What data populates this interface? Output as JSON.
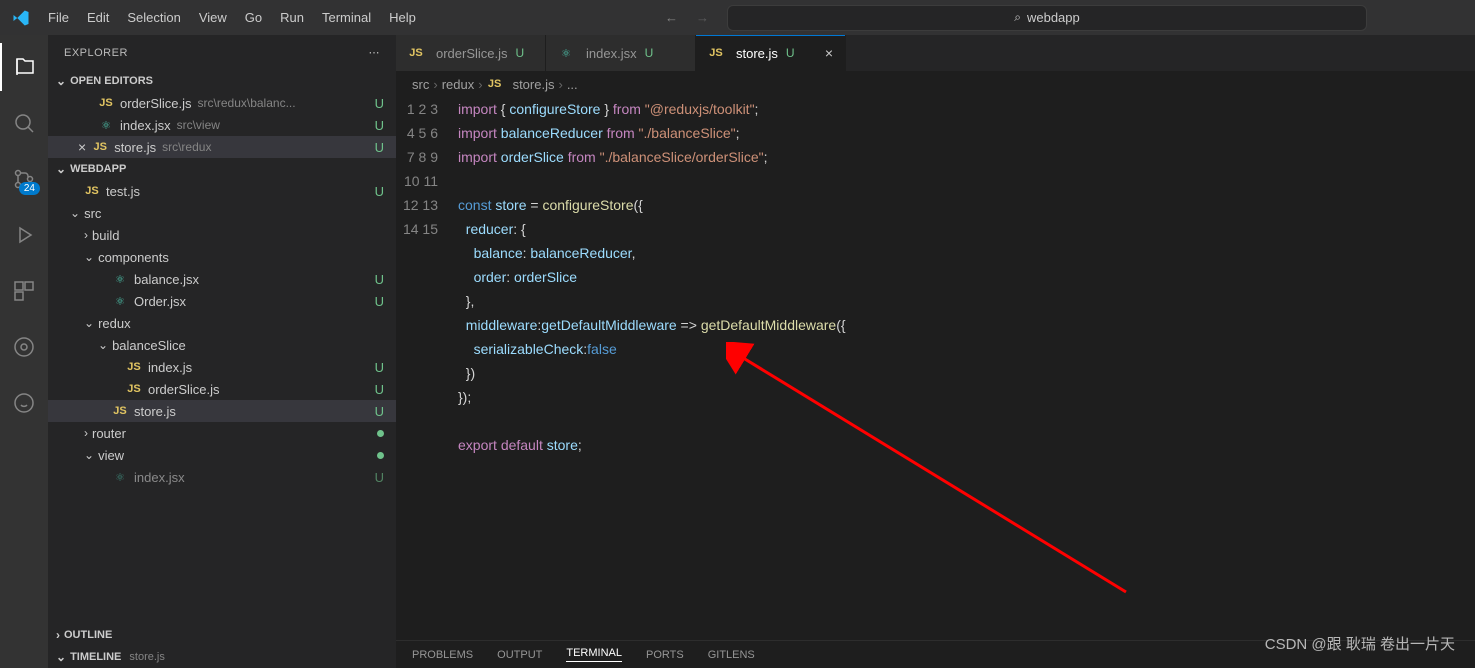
{
  "menu": [
    "File",
    "Edit",
    "Selection",
    "View",
    "Go",
    "Run",
    "Terminal",
    "Help"
  ],
  "search": {
    "placeholder": "webdapp"
  },
  "activity": {
    "badge": "24"
  },
  "sidebar": {
    "title": "EXPLORER",
    "openEditors": {
      "label": "OPEN EDITORS",
      "items": [
        {
          "icon": "JS",
          "name": "orderSlice.js",
          "path": "src\\redux\\balanc...",
          "status": "U"
        },
        {
          "icon": "⚛",
          "name": "index.jsx",
          "path": "src\\view",
          "status": "U"
        },
        {
          "icon": "JS",
          "name": "store.js",
          "path": "src\\redux",
          "status": "U",
          "active": true
        }
      ]
    },
    "project": {
      "label": "WEBDAPP",
      "tree": [
        {
          "indent": 1,
          "icon": "JS",
          "name": "test.js",
          "status": "U"
        },
        {
          "indent": 1,
          "chev": "down",
          "name": "src"
        },
        {
          "indent": 2,
          "chev": "right",
          "name": "build"
        },
        {
          "indent": 2,
          "chev": "down",
          "name": "components"
        },
        {
          "indent": 3,
          "icon": "⚛",
          "name": "balance.jsx",
          "status": "U"
        },
        {
          "indent": 3,
          "icon": "⚛",
          "name": "Order.jsx",
          "status": "U"
        },
        {
          "indent": 2,
          "chev": "down",
          "name": "redux"
        },
        {
          "indent": 3,
          "chev": "down",
          "name": "balanceSlice"
        },
        {
          "indent": 4,
          "icon": "JS",
          "name": "index.js",
          "status": "U"
        },
        {
          "indent": 4,
          "icon": "JS",
          "name": "orderSlice.js",
          "status": "U"
        },
        {
          "indent": 3,
          "icon": "JS",
          "name": "store.js",
          "status": "U",
          "selected": true
        },
        {
          "indent": 2,
          "chev": "right",
          "name": "router",
          "dot": true
        },
        {
          "indent": 2,
          "chev": "down",
          "name": "view",
          "dot": true
        },
        {
          "indent": 3,
          "icon": "⚛",
          "name": "index.jsx",
          "status": "U",
          "dim": true
        }
      ]
    },
    "outline": {
      "label": "OUTLINE"
    },
    "timeline": {
      "label": "TIMELINE",
      "sub": "store.js"
    }
  },
  "tabs": [
    {
      "icon": "JS",
      "name": "orderSlice.js",
      "status": "U"
    },
    {
      "icon": "⚛",
      "name": "index.jsx",
      "status": "U"
    },
    {
      "icon": "JS",
      "name": "store.js",
      "status": "U",
      "active": true,
      "close": true
    }
  ],
  "breadcrumb": [
    "src",
    "redux",
    "store.js",
    "..."
  ],
  "breadcrumb_icon": "JS",
  "code": {
    "lines": [
      [
        {
          "t": "import",
          "c": "kw"
        },
        {
          "t": " { "
        },
        {
          "t": "configureStore",
          "c": "var"
        },
        {
          "t": " } "
        },
        {
          "t": "from",
          "c": "kw"
        },
        {
          "t": " "
        },
        {
          "t": "\"@reduxjs/toolkit\"",
          "c": "str"
        },
        {
          "t": ";"
        }
      ],
      [
        {
          "t": "import",
          "c": "kw"
        },
        {
          "t": " "
        },
        {
          "t": "balanceReducer",
          "c": "var"
        },
        {
          "t": " "
        },
        {
          "t": "from",
          "c": "kw"
        },
        {
          "t": " "
        },
        {
          "t": "\"./balanceSlice\"",
          "c": "str"
        },
        {
          "t": ";"
        }
      ],
      [
        {
          "t": "import",
          "c": "kw"
        },
        {
          "t": " "
        },
        {
          "t": "orderSlice",
          "c": "var"
        },
        {
          "t": " "
        },
        {
          "t": "from",
          "c": "kw"
        },
        {
          "t": " "
        },
        {
          "t": "\"./balanceSlice/orderSlice\"",
          "c": "str"
        },
        {
          "t": ";"
        }
      ],
      [],
      [
        {
          "t": "const",
          "c": "const"
        },
        {
          "t": " "
        },
        {
          "t": "store",
          "c": "var"
        },
        {
          "t": " = "
        },
        {
          "t": "configureStore",
          "c": "fn"
        },
        {
          "t": "({"
        }
      ],
      [
        {
          "t": "  "
        },
        {
          "t": "reducer",
          "c": "prop"
        },
        {
          "t": ": {"
        }
      ],
      [
        {
          "t": "    "
        },
        {
          "t": "balance",
          "c": "prop"
        },
        {
          "t": ": "
        },
        {
          "t": "balanceReducer",
          "c": "var"
        },
        {
          "t": ","
        }
      ],
      [
        {
          "t": "    "
        },
        {
          "t": "order",
          "c": "prop"
        },
        {
          "t": ": "
        },
        {
          "t": "orderSlice",
          "c": "var"
        }
      ],
      [
        {
          "t": "  },"
        }
      ],
      [
        {
          "t": "  "
        },
        {
          "t": "middleware",
          "c": "prop"
        },
        {
          "t": ":"
        },
        {
          "t": "getDefaultMiddleware",
          "c": "var"
        },
        {
          "t": " => "
        },
        {
          "t": "getDefaultMiddleware",
          "c": "fn"
        },
        {
          "t": "({"
        }
      ],
      [
        {
          "t": "    "
        },
        {
          "t": "serializableCheck",
          "c": "prop"
        },
        {
          "t": ":"
        },
        {
          "t": "false",
          "c": "const"
        }
      ],
      [
        {
          "t": "  })"
        }
      ],
      [
        {
          "t": "});"
        }
      ],
      [],
      [
        {
          "t": "export",
          "c": "kw"
        },
        {
          "t": " "
        },
        {
          "t": "default",
          "c": "kw"
        },
        {
          "t": " "
        },
        {
          "t": "store",
          "c": "var"
        },
        {
          "t": ";"
        }
      ]
    ]
  },
  "panel": [
    "PROBLEMS",
    "OUTPUT",
    "TERMINAL",
    "PORTS",
    "GITLENS"
  ],
  "panel_active": "TERMINAL",
  "watermark": "CSDN @跟 耿瑞 卷出一片天"
}
